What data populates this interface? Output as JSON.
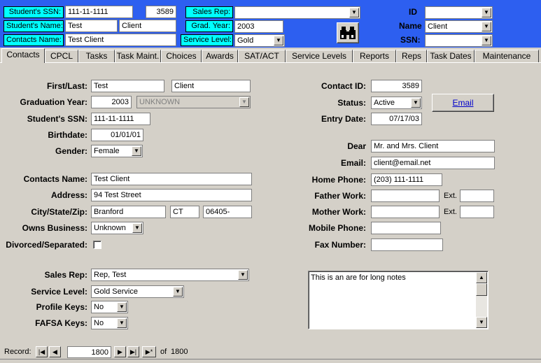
{
  "header": {
    "ssn_label": "Student's SSN:",
    "ssn_value": "111-11-1111",
    "id_number": "3589",
    "name_label": "Student's Name:",
    "first_name": "Test",
    "last_name": "Client",
    "contacts_label": "Contacts Name:",
    "contacts_value": "Test Client",
    "sales_rep_label": "Sales Rep:",
    "sales_rep_value": "",
    "grad_year_label": "Grad. Year:",
    "grad_year_value": "2003",
    "service_level_label": "Service Level:",
    "service_level_value": "Gold",
    "search_icon": "binoculars-icon",
    "id_label": "ID",
    "id_combo_value": "",
    "name_label_right": "Name",
    "name_combo_value": "Client",
    "ssn_label_right": "SSN:",
    "ssn_combo_value": ""
  },
  "tabs": [
    {
      "label": "Contacts",
      "active": true
    },
    {
      "label": "CPCL"
    },
    {
      "label": "Tasks"
    },
    {
      "label": "Task Maint."
    },
    {
      "label": "Choices"
    },
    {
      "label": "Awards"
    },
    {
      "label": "SAT/ACT"
    },
    {
      "label": "Service Levels"
    },
    {
      "label": "Reports"
    },
    {
      "label": "Reps"
    },
    {
      "label": "Task Dates"
    },
    {
      "label": "Maintenance"
    }
  ],
  "form": {
    "first_last_label": "First/Last:",
    "first": "Test",
    "last": "Client",
    "grad_year_label": "Graduation Year:",
    "grad_year": "2003",
    "grad_status": "UNKNOWN",
    "ssn_label": "Student's SSN:",
    "ssn": "111-11-1111",
    "birthdate_label": "Birthdate:",
    "birthdate": "01/01/01",
    "gender_label": "Gender:",
    "gender": "Female",
    "contacts_name_label": "Contacts Name:",
    "contacts_name": "Test Client",
    "address_label": "Address:",
    "address": "94 Test Street",
    "csz_label": "City/State/Zip:",
    "city": "Branford",
    "state": "CT",
    "zip": "06405-",
    "owns_business_label": "Owns Business:",
    "owns_business": "Unknown",
    "divorced_label": "Divorced/Separated:",
    "sales_rep_label": "Sales Rep:",
    "sales_rep": "Rep, Test",
    "service_level_label": "Service Level:",
    "service_level": "Gold Service",
    "profile_keys_label": "Profile  Keys:",
    "profile_keys": "No",
    "fafsa_keys_label": "FAFSA Keys:",
    "fafsa_keys": "No",
    "contact_id_label": "Contact ID:",
    "contact_id": "3589",
    "status_label": "Status:",
    "status": "Active",
    "entry_date_label": "Entry Date:",
    "entry_date": "07/17/03",
    "email_button": "Email",
    "dear_label": "Dear",
    "dear": "Mr. and Mrs. Client",
    "email_label": "Email:",
    "email": "client@email.net",
    "home_phone_label": "Home Phone:",
    "home_phone": "(203) 111-1111",
    "father_work_label": "Father Work:",
    "father_work": "",
    "mother_work_label": "Mother Work:",
    "mother_work": "",
    "ext_label": "Ext.",
    "mobile_label": "Mobile Phone:",
    "mobile": "",
    "fax_label": "Fax Number:",
    "fax": "",
    "notes": "This is an are for long notes"
  },
  "record_nav": {
    "label": "Record:",
    "current": "1800",
    "of_label": "of",
    "total": "1800"
  },
  "colors": {
    "header_bg": "#2d5ff0",
    "label_bg": "#00ffff",
    "window_bg": "#d4d0c8",
    "link": "#0000cc"
  }
}
